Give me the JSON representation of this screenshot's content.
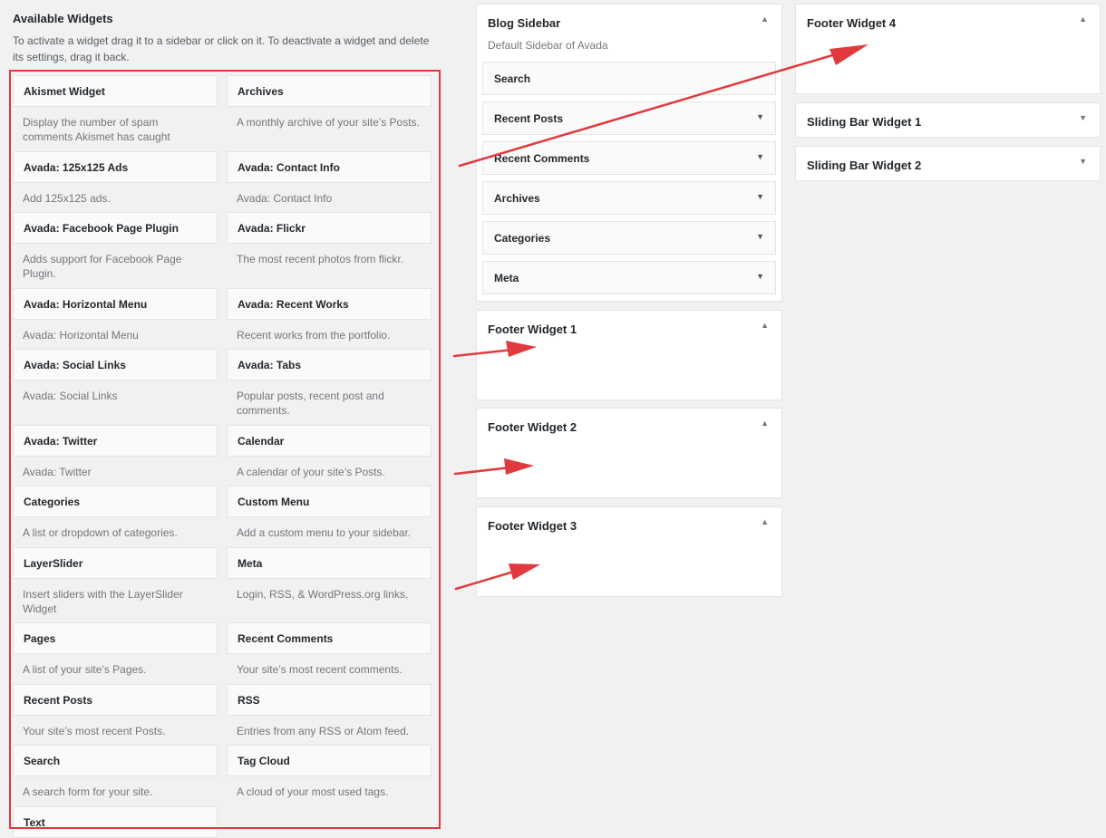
{
  "available": {
    "title": "Available Widgets",
    "description": "To activate a widget drag it to a sidebar or click on it. To deactivate a widget and delete its settings, drag it back.",
    "widgets": [
      {
        "name": "Akismet Widget",
        "desc": "Display the number of spam comments Akismet has caught"
      },
      {
        "name": "Archives",
        "desc": "A monthly archive of your site’s Posts."
      },
      {
        "name": "Avada: 125x125 Ads",
        "desc": "Add 125x125 ads."
      },
      {
        "name": "Avada: Contact Info",
        "desc": "Avada: Contact Info"
      },
      {
        "name": "Avada: Facebook Page Plugin",
        "desc": "Adds support for Facebook Page Plugin."
      },
      {
        "name": "Avada: Flickr",
        "desc": "The most recent photos from flickr."
      },
      {
        "name": "Avada: Horizontal Menu",
        "desc": "Avada: Horizontal Menu"
      },
      {
        "name": "Avada: Recent Works",
        "desc": "Recent works from the portfolio."
      },
      {
        "name": "Avada: Social Links",
        "desc": "Avada: Social Links"
      },
      {
        "name": "Avada: Tabs",
        "desc": "Popular posts, recent post and comments."
      },
      {
        "name": "Avada: Twitter",
        "desc": "Avada: Twitter"
      },
      {
        "name": "Calendar",
        "desc": "A calendar of your site’s Posts."
      },
      {
        "name": "Categories",
        "desc": "A list or dropdown of categories."
      },
      {
        "name": "Custom Menu",
        "desc": "Add a custom menu to your sidebar."
      },
      {
        "name": "LayerSlider",
        "desc": "Insert sliders with the LayerSlider Widget"
      },
      {
        "name": "Meta",
        "desc": "Login, RSS, & WordPress.org links."
      },
      {
        "name": "Pages",
        "desc": "A list of your site’s Pages."
      },
      {
        "name": "Recent Comments",
        "desc": "Your site’s most recent comments."
      },
      {
        "name": "Recent Posts",
        "desc": "Your site’s most recent Posts."
      },
      {
        "name": "RSS",
        "desc": "Entries from any RSS or Atom feed."
      },
      {
        "name": "Search",
        "desc": "A search form for your site."
      },
      {
        "name": "Tag Cloud",
        "desc": "A cloud of your most used tags."
      },
      {
        "name": "Text",
        "desc": ""
      }
    ]
  },
  "sidebars": {
    "blog": {
      "title": "Blog Sidebar",
      "subtitle": "Default Sidebar of Avada",
      "widgets": [
        "Search",
        "Recent Posts",
        "Recent Comments",
        "Archives",
        "Categories",
        "Meta"
      ]
    },
    "footer1": {
      "title": "Footer Widget 1"
    },
    "footer2": {
      "title": "Footer Widget 2"
    },
    "footer3": {
      "title": "Footer Widget 3"
    },
    "footer4": {
      "title": "Footer Widget 4"
    },
    "sliding1": {
      "title": "Sliding Bar Widget 1"
    },
    "sliding2": {
      "title": "Sliding Bar Widget 2"
    }
  },
  "icons": {
    "arrow_up": "▲",
    "arrow_down": "▼"
  },
  "colors": {
    "annotation": "#e03a3e"
  }
}
